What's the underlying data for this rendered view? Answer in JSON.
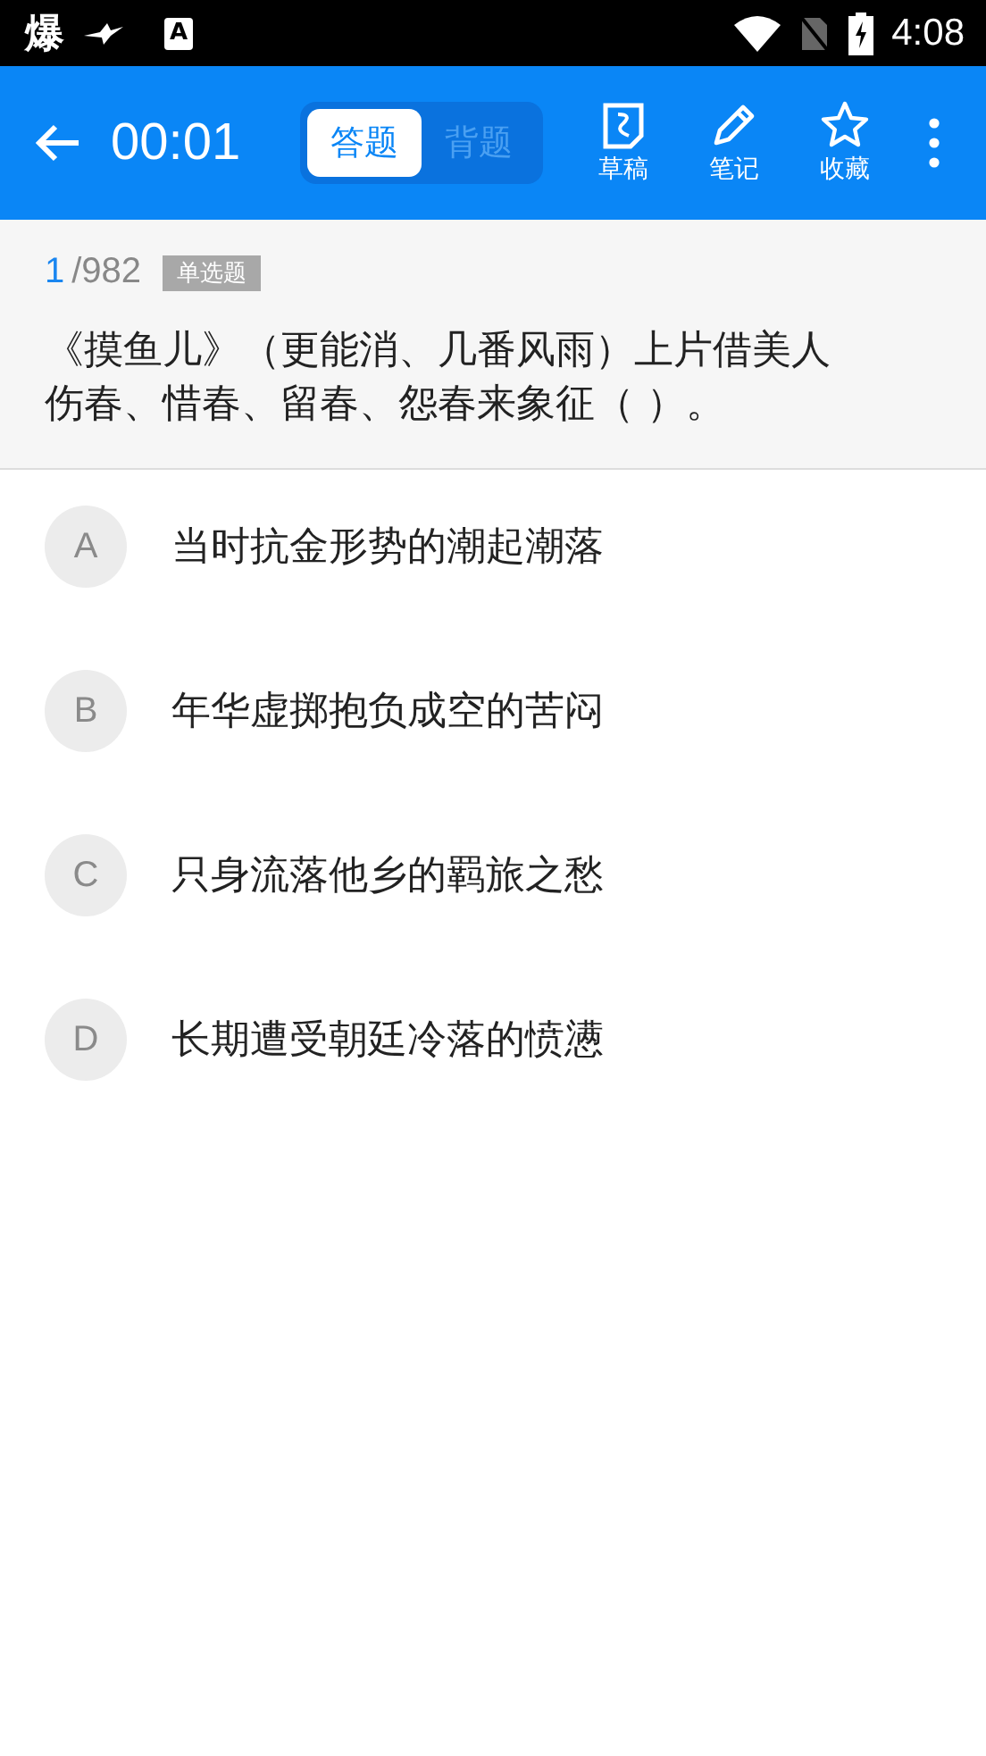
{
  "status_bar": {
    "notification_glyph": "爆",
    "notification_letter": "A",
    "time": "4:08"
  },
  "header": {
    "timer": "00:01",
    "modes": [
      {
        "label": "答题",
        "selected": true
      },
      {
        "label": "背题",
        "selected": false
      }
    ],
    "actions": [
      {
        "kind": "draft",
        "label": "草稿"
      },
      {
        "kind": "note",
        "label": "笔记"
      },
      {
        "kind": "star",
        "label": "收藏"
      }
    ]
  },
  "question": {
    "index": "1",
    "total": "/982",
    "type": "单选题",
    "text": "《摸鱼儿》（更能消、几番风雨）上片借美人伤春、惜春、留春、怨春来象征（ ）。"
  },
  "options": [
    {
      "letter": "A",
      "text": "当时抗金形势的潮起潮落",
      "selected": false
    },
    {
      "letter": "B",
      "text": "年华虚掷抱负成空的苦闷",
      "selected": false
    },
    {
      "letter": "C",
      "text": "只身流落他乡的羁旅之愁",
      "selected": false
    },
    {
      "letter": "D",
      "text": "长期遭受朝廷冷落的愤懑",
      "selected": false
    }
  ]
}
